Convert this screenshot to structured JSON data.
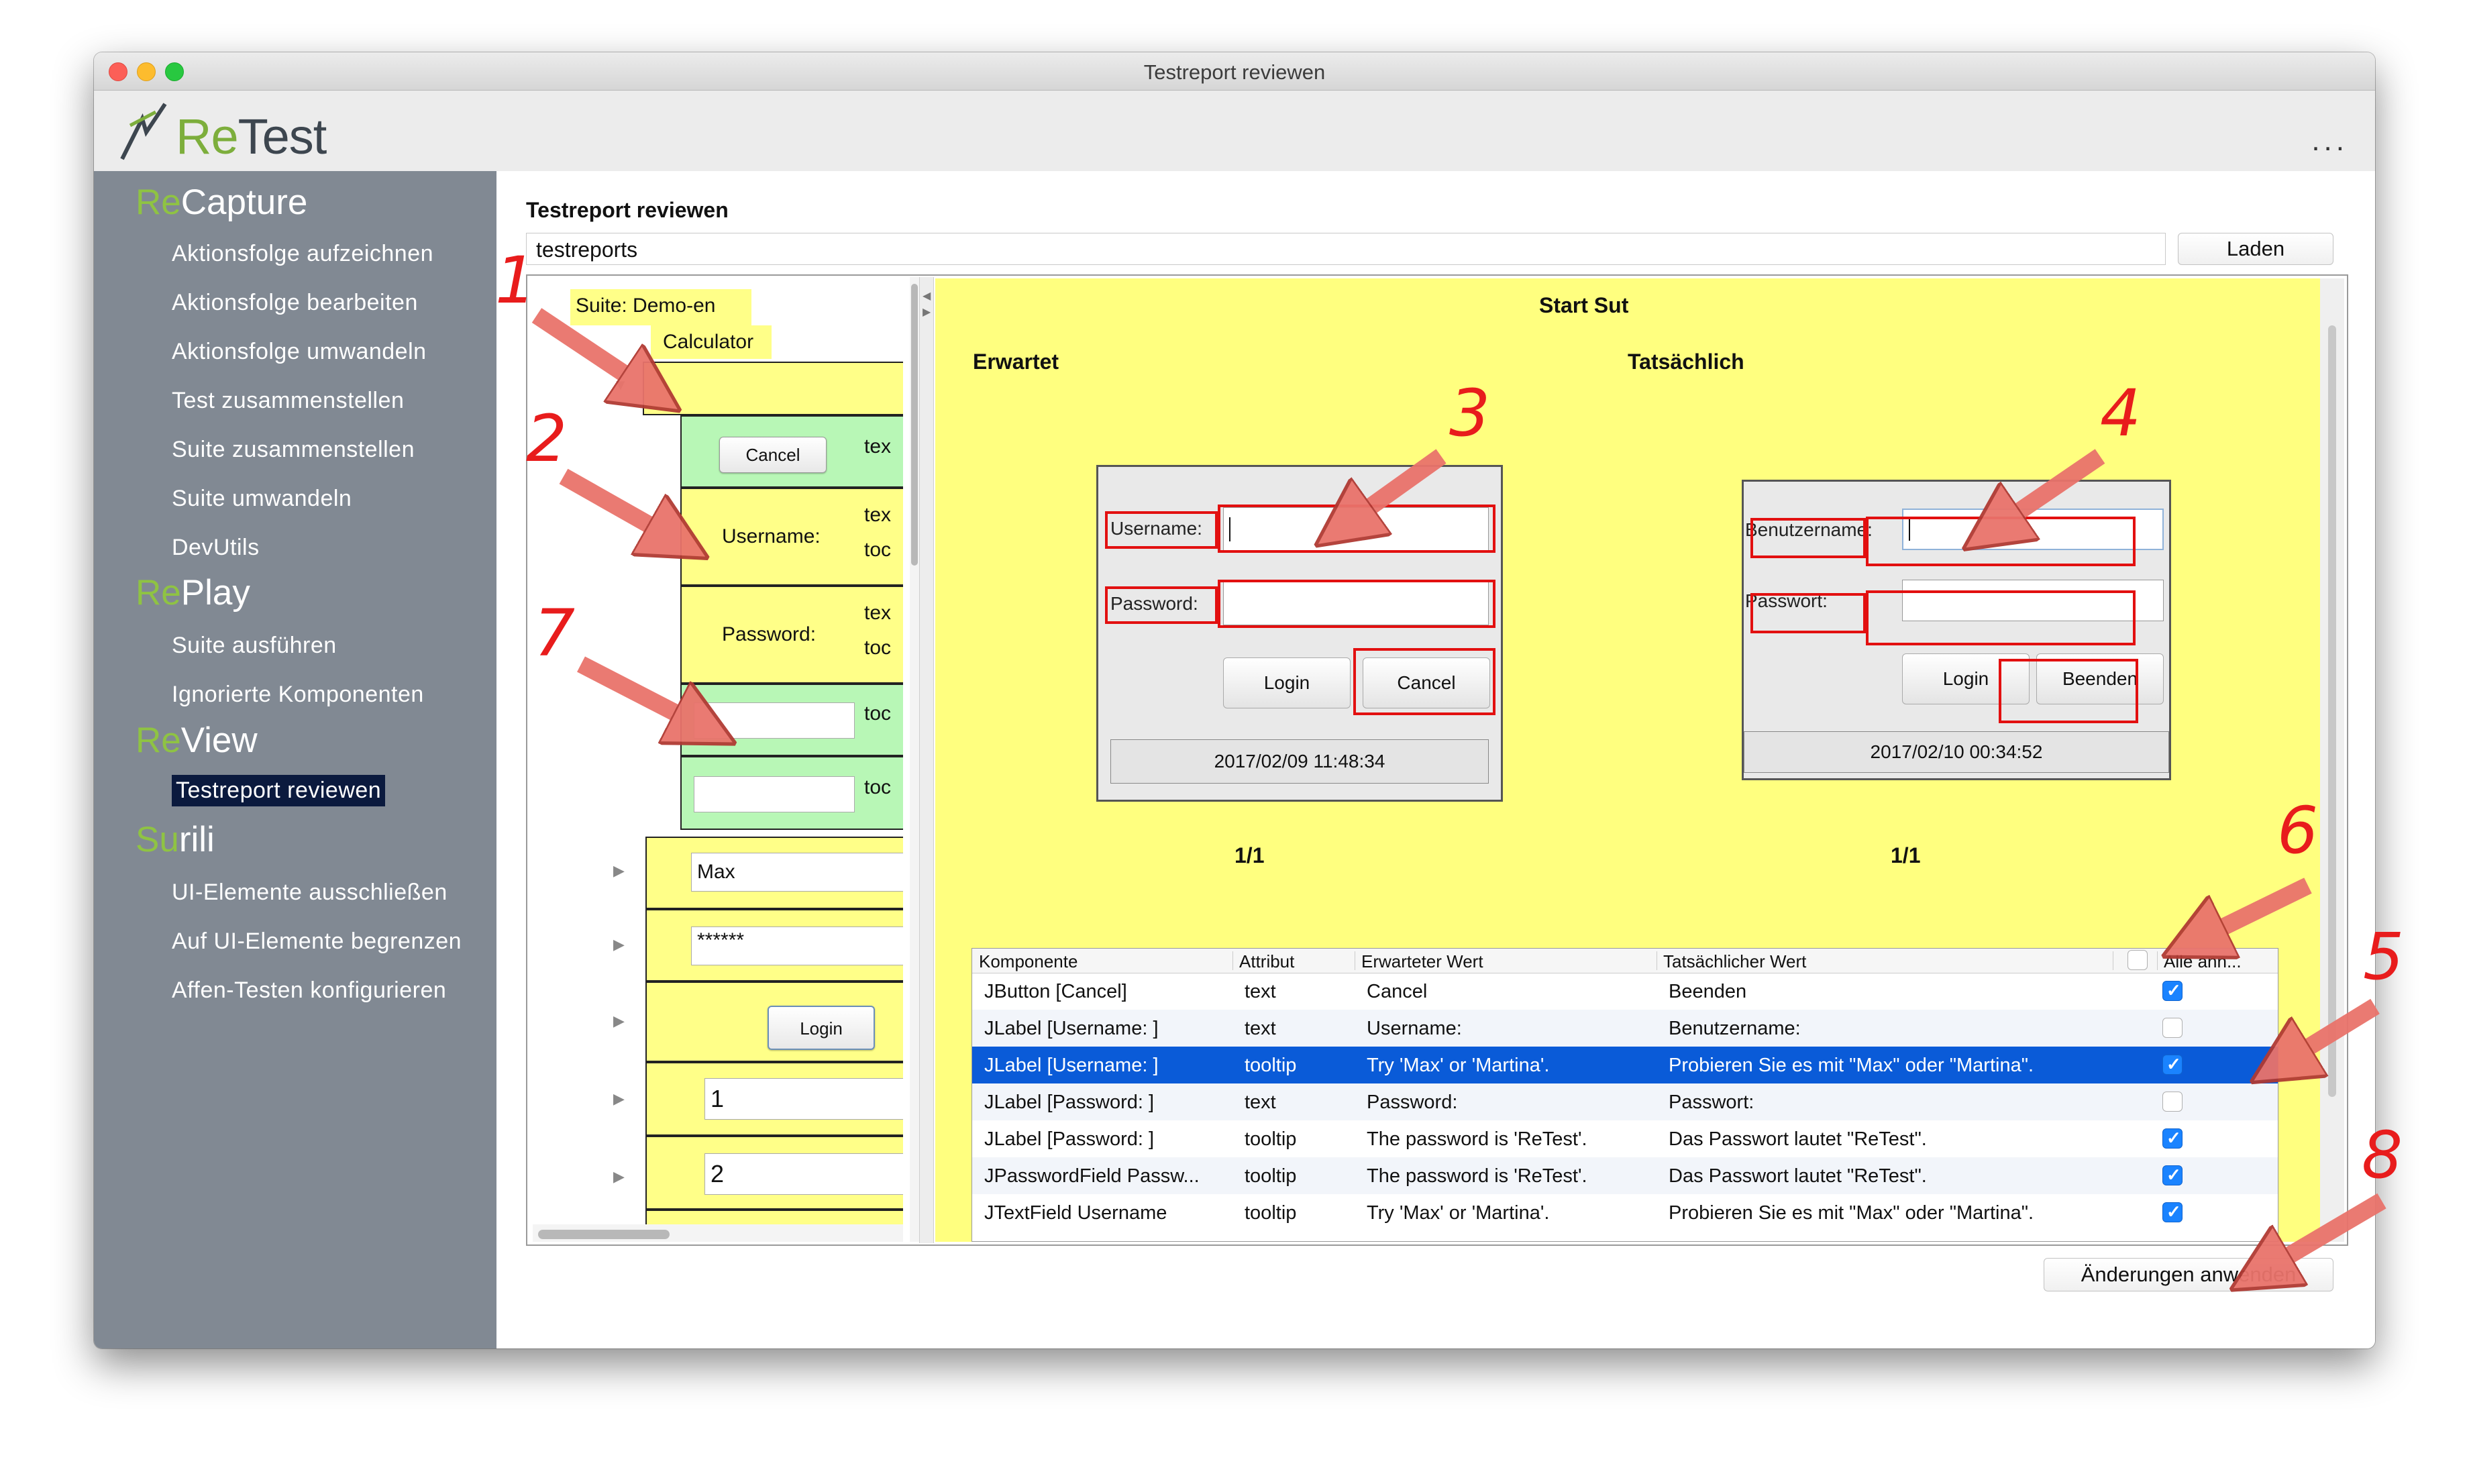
{
  "window": {
    "title": "Testreport reviewen"
  },
  "header": {
    "logo_re": "Re",
    "logo_test": "Test",
    "more": "..."
  },
  "sidebar": {
    "sections": [
      {
        "prefix": "Re",
        "rest": "Capture"
      },
      {
        "prefix": "Re",
        "rest": "Play"
      },
      {
        "prefix": "Re",
        "rest": "View"
      },
      {
        "prefix": "Su",
        "rest": "rili"
      }
    ],
    "items": [
      "Aktionsfolge aufzeichnen",
      "Aktionsfolge bearbeiten",
      "Aktionsfolge umwandeln",
      "Test zusammenstellen",
      "Suite zusammenstellen",
      "Suite umwandeln",
      "DevUtils",
      "Suite ausführen",
      "Ignorierte Komponenten",
      "Testreport reviewen",
      "UI-Elemente ausschließen",
      "Auf UI-Elemente begrenzen",
      "Affen-Testen konfigurieren"
    ]
  },
  "main": {
    "title": "Testreport reviewen",
    "path_value": "testreports",
    "load_button": "Laden",
    "apply_button": "Änderungen anwenden"
  },
  "tree": {
    "suite": "Suite: Demo-en",
    "test": "Calculator",
    "cancel_btn": "Cancel",
    "username_label": "Username:",
    "password_label": "Password:",
    "col_text": "tex",
    "col_tooltip": "toc",
    "field_max": "Max",
    "field_password": "******",
    "login_btn": "Login",
    "field_one": "1",
    "field_two": "2"
  },
  "review": {
    "heading": "Start Sut",
    "expected": "Erwartet",
    "actual": "Tatsächlich",
    "expected_shot": {
      "username": "Username:",
      "password": "Password:",
      "login": "Login",
      "cancel": "Cancel",
      "status": "2017/02/09 11:48:34"
    },
    "actual_shot": {
      "username": "Benutzername:",
      "password": "Passwort:",
      "login": "Login",
      "cancel": "Beenden",
      "status": "2017/02/10 00:34:52"
    },
    "page_left": "1/1",
    "page_right": "1/1"
  },
  "table": {
    "headers": [
      "Komponente",
      "Attribut",
      "Erwarteter Wert",
      "Tatsächlicher Wert",
      "Alle ann..."
    ],
    "rows": [
      {
        "component": "JButton [Cancel]",
        "attribute": "text",
        "expected": "Cancel",
        "actual": "Beenden",
        "checked": true
      },
      {
        "component": "JLabel [Username: ]",
        "attribute": "text",
        "expected": "Username:",
        "actual": "Benutzername:",
        "checked": false
      },
      {
        "component": "JLabel [Username: ]",
        "attribute": "tooltip",
        "expected": "Try 'Max' or 'Martina'.",
        "actual": "Probieren Sie es mit \"Max\" oder \"Martina\".",
        "checked": true
      },
      {
        "component": "JLabel [Password: ]",
        "attribute": "text",
        "expected": "Password:",
        "actual": "Passwort:",
        "checked": false
      },
      {
        "component": "JLabel [Password: ]",
        "attribute": "tooltip",
        "expected": "The password is 'ReTest'.",
        "actual": "Das Passwort lautet \"ReTest\".",
        "checked": true
      },
      {
        "component": "JPasswordField Passw...",
        "attribute": "tooltip",
        "expected": "The password is 'ReTest'.",
        "actual": "Das Passwort lautet \"ReTest\".",
        "checked": true
      },
      {
        "component": "JTextField Username",
        "attribute": "tooltip",
        "expected": "Try 'Max' or 'Martina'.",
        "actual": "Probieren Sie es mit \"Max\" oder \"Martina\".",
        "checked": true
      }
    ],
    "selected_row": 2
  },
  "annotations": [
    "1",
    "2",
    "3",
    "4",
    "5",
    "6",
    "7",
    "8"
  ],
  "colors": {
    "annotation": "#e81c1c",
    "sidebar": "#818993",
    "selection": "#0a5bd8",
    "tree_yellow": "#ffff88",
    "tree_green": "#b8f7b6"
  },
  "icons": {
    "expander": "triangle-right-icon",
    "expanded": "triangle-down-icon"
  }
}
